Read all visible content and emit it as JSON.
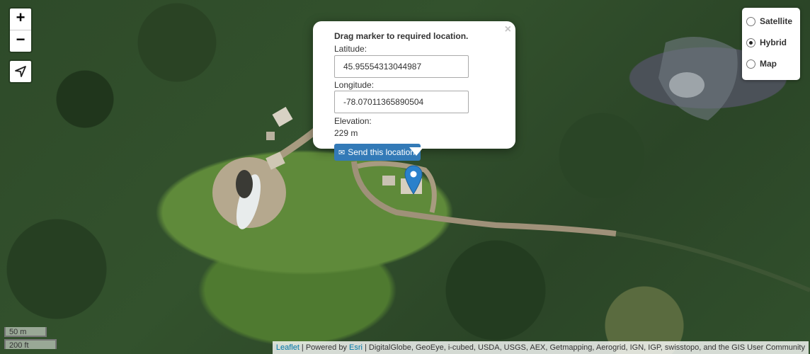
{
  "map": {
    "zoom_in": "+",
    "zoom_out": "−",
    "locate_icon": "navigation-arrow-icon"
  },
  "layers": {
    "options": [
      {
        "label": "Satellite",
        "checked": false
      },
      {
        "label": "Hybrid",
        "checked": true
      },
      {
        "label": "Map",
        "checked": false
      }
    ]
  },
  "popup": {
    "close": "×",
    "title": "Drag marker to required location.",
    "latitude_label": "Latitude:",
    "latitude_value": "45.95554313044987",
    "longitude_label": "Longitude:",
    "longitude_value": "-78.07011365890504",
    "elevation_label": "Elevation:",
    "elevation_value": "229 m",
    "send_button": "Send this location",
    "send_icon": "envelope-icon"
  },
  "marker": {
    "color": "#2a81cb",
    "icon": "map-marker-icon"
  },
  "scale": {
    "metric": "50 m",
    "imperial": "200 ft"
  },
  "attribution": {
    "leaflet": "Leaflet",
    "sep1": " | Powered by ",
    "esri": "Esri",
    "rest": " | DigitalGlobe, GeoEye, i-cubed, USDA, USGS, AEX, Getmapping, Aerogrid, IGN, IGP, swisstopo, and the GIS User Community"
  }
}
